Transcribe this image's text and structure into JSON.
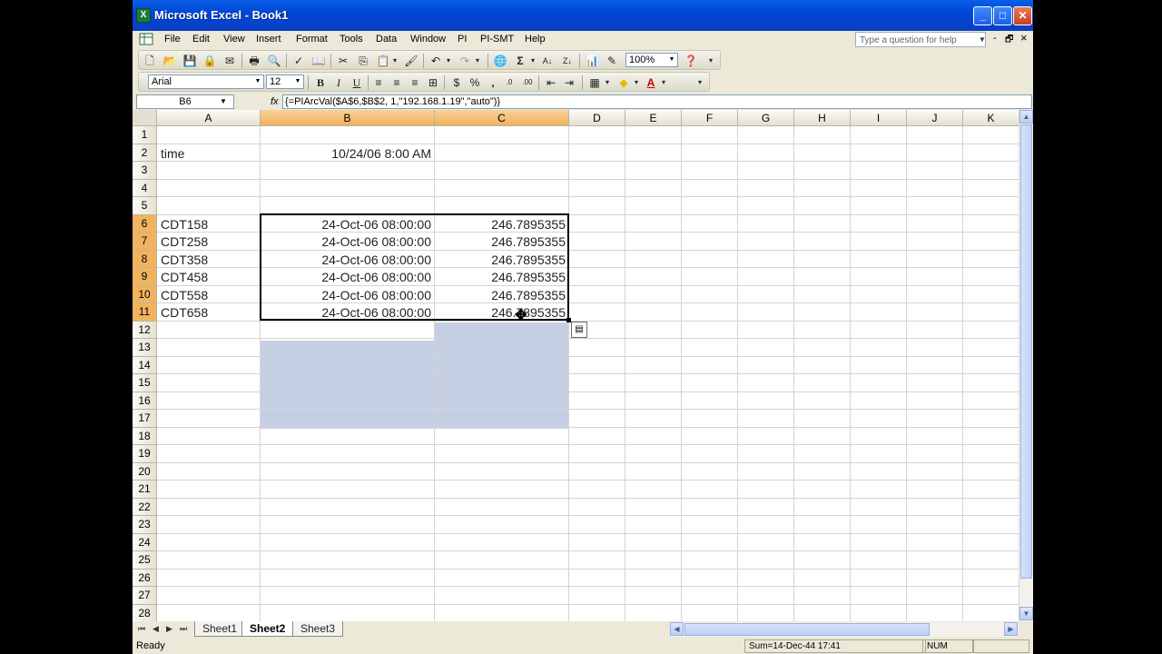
{
  "window": {
    "title": "Microsoft Excel - Book1",
    "app_icon": "X",
    "minimize": "_",
    "maximize": "□",
    "close": "✕"
  },
  "menu": {
    "items": [
      "File",
      "Edit",
      "View",
      "Insert",
      "Format",
      "Tools",
      "Data",
      "Window",
      "PI",
      "PI-SMT",
      "Help"
    ],
    "help_placeholder": "Type a question for help",
    "mdi_min": "-",
    "mdi_restore": "🗗",
    "mdi_close": "×"
  },
  "toolbar": {
    "zoom": "100%",
    "font": "Arial",
    "font_size": "12"
  },
  "formula_bar": {
    "name_box": "B6",
    "fx": "fx",
    "formula": "{=PIArcVal($A$6,$B$2, 1,\"192.168.1.19\",\"auto\")}"
  },
  "grid": {
    "columns": [
      "A",
      "B",
      "C",
      "D",
      "E",
      "F",
      "G",
      "H",
      "I",
      "J",
      "K"
    ],
    "rows": [
      "1",
      "2",
      "3",
      "4",
      "5",
      "6",
      "7",
      "8",
      "9",
      "10",
      "11",
      "12",
      "13",
      "14",
      "15",
      "16",
      "17",
      "18",
      "19",
      "20",
      "21",
      "22",
      "23",
      "24",
      "25",
      "26",
      "27",
      "28"
    ],
    "a2": "time",
    "b2": "10/24/06 8:00 AM",
    "data_rows": [
      {
        "tag": "CDT158",
        "time": "24-Oct-06 08:00:00",
        "value": "246.7895355"
      },
      {
        "tag": "CDT258",
        "time": "24-Oct-06 08:00:00",
        "value": "246.7895355"
      },
      {
        "tag": "CDT358",
        "time": "24-Oct-06 08:00:00",
        "value": "246.7895355"
      },
      {
        "tag": "CDT458",
        "time": "24-Oct-06 08:00:00",
        "value": "246.7895355"
      },
      {
        "tag": "CDT558",
        "time": "24-Oct-06 08:00:00",
        "value": "246.7895355"
      },
      {
        "tag": "CDT658",
        "time": "24-Oct-06 08:00:00",
        "value": "246.7895355"
      }
    ]
  },
  "sheets": {
    "tabs": [
      "Sheet1",
      "Sheet2",
      "Sheet3"
    ],
    "active": "Sheet2"
  },
  "status": {
    "mode": "Ready",
    "sum": "Sum=14-Dec-44 17:41",
    "num": "NUM"
  }
}
